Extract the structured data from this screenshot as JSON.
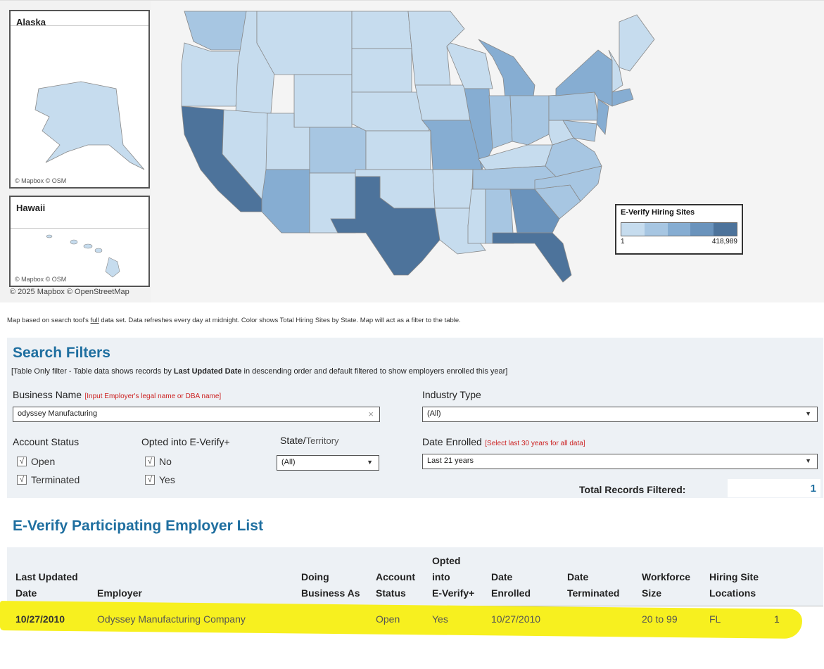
{
  "map": {
    "alaska_title": "Alaska",
    "hawaii_title": "Hawaii",
    "inset_attribution": "© Mapbox  © OSM",
    "attribution": "© 2025 Mapbox  © OpenStreetMap",
    "note_pre": "Map based on search tool's ",
    "note_link": "full",
    "note_post": " data set. Data refreshes every day at midnight. Color shows Total Hiring Sites by State. Map will act as a filter to the table.",
    "legend": {
      "title": "E-Verify Hiring Sites",
      "min": "1",
      "max": "418,989",
      "colors": [
        "#c6dcee",
        "#a7c6e2",
        "#86add2",
        "#6a93bc",
        "#4d739b"
      ]
    }
  },
  "filters": {
    "heading": "Search Filters",
    "subtitle_pre": "[Table Only filter - Table data shows records by ",
    "subtitle_bold": "Last Updated Date",
    "subtitle_post": " in descending order and default filtered to show employers enrolled this year]",
    "business_name_label": "Business Name",
    "business_name_hint": "[Input Employer's legal name or DBA name]",
    "business_name_value": "odyssey Manufacturing",
    "clear_icon": "×",
    "industry_type_label": "Industry Type",
    "industry_type_value": "(All)",
    "account_status_label": "Account Status",
    "account_status_options": [
      "Open",
      "Terminated"
    ],
    "opted_label": "Opted into E-Verify+",
    "opted_options": [
      "No",
      "Yes"
    ],
    "state_label_main": "State/",
    "state_label_rest": "Territory",
    "state_value": "(All)",
    "date_enrolled_label": "Date Enrolled",
    "date_enrolled_hint": "[Select last 30 years for all data]",
    "date_enrolled_value": "Last 21 years",
    "total_label": "Total Records Filtered:",
    "total_value": "1",
    "checkmark": "√",
    "dropdown_arrow": "▼"
  },
  "table": {
    "heading": "E-Verify Participating Employer List",
    "columns": [
      {
        "lines": [
          "",
          "Last Updated",
          "Date"
        ]
      },
      {
        "lines": [
          "",
          "",
          "Employer"
        ]
      },
      {
        "lines": [
          "",
          "Doing",
          "Business As"
        ]
      },
      {
        "lines": [
          "",
          "Account",
          "Status"
        ]
      },
      {
        "lines": [
          "Opted",
          "into",
          "E-Verify+"
        ]
      },
      {
        "lines": [
          "",
          "Date",
          "Enrolled"
        ]
      },
      {
        "lines": [
          "",
          "Date",
          "Terminated"
        ]
      },
      {
        "lines": [
          "",
          "Workforce",
          "Size"
        ]
      },
      {
        "lines": [
          "",
          "Hiring Site",
          "Locations"
        ]
      }
    ],
    "row": {
      "last_updated": "10/27/2010",
      "employer": "Odyssey Manufacturing Company",
      "dba": "",
      "account_status": "Open",
      "opted": "Yes",
      "date_enrolled": "10/27/2010",
      "date_terminated": "",
      "workforce": "20 to 99",
      "locations": "FL",
      "count": "1"
    }
  }
}
